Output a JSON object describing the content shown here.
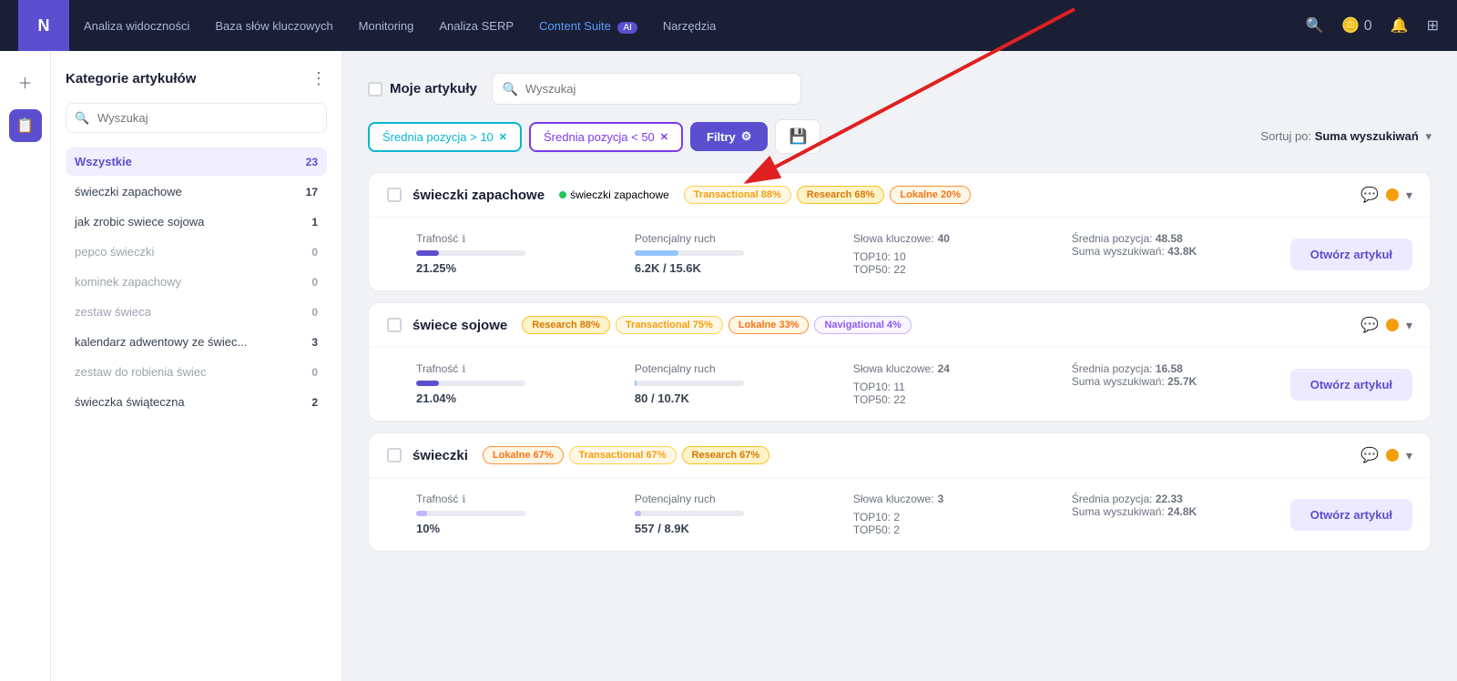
{
  "nav": {
    "logo": "N",
    "links": [
      {
        "label": "Analiza widoczności",
        "active": false
      },
      {
        "label": "Baza słów kluczowych",
        "active": false
      },
      {
        "label": "Monitoring",
        "active": false
      },
      {
        "label": "Analiza SERP",
        "active": false
      },
      {
        "label": "Content Suite",
        "active": true,
        "highlight": true,
        "badge": "AI"
      },
      {
        "label": "Narzędzia",
        "active": false
      }
    ],
    "icons": [
      "search",
      "coins",
      "bell",
      "grid"
    ]
  },
  "sidebar_icons": [
    {
      "icon": "＋",
      "active": false
    },
    {
      "icon": "📅",
      "active": true
    }
  ],
  "left_panel": {
    "title": "Kategorie artykułów",
    "search_placeholder": "Wyszukaj",
    "categories": [
      {
        "name": "Wszystkie",
        "count": "23",
        "active": true,
        "disabled": false
      },
      {
        "name": "świeczki zapachowe",
        "count": "17",
        "active": false,
        "disabled": false
      },
      {
        "name": "jak zrobic swiece sojowa",
        "count": "1",
        "active": false,
        "disabled": false
      },
      {
        "name": "pepco świeczki",
        "count": "0",
        "active": false,
        "disabled": true
      },
      {
        "name": "kominek zapachowy",
        "count": "0",
        "active": false,
        "disabled": true
      },
      {
        "name": "zestaw świeca",
        "count": "0",
        "active": false,
        "disabled": true
      },
      {
        "name": "kalendarz adwentowy ze świec...",
        "count": "3",
        "active": false,
        "disabled": false
      },
      {
        "name": "zestaw do robienia świec",
        "count": "0",
        "active": false,
        "disabled": true
      },
      {
        "name": "świeczka świąteczna",
        "count": "2",
        "active": false,
        "disabled": false
      }
    ]
  },
  "main": {
    "my_articles_label": "Moje artykuły",
    "search_placeholder": "Wyszukaj",
    "filters": [
      {
        "label": "Średnia pozycja > 10",
        "type": "cyan"
      },
      {
        "label": "Średnia pozycja < 50",
        "type": "violet"
      }
    ],
    "filter_button": "Filtry",
    "sort_label": "Sortuj po:",
    "sort_value": "Suma wyszukiwań",
    "articles": [
      {
        "title": "świeczki zapachowe",
        "keyword": "świeczki zapachowe",
        "intents": [
          {
            "label": "Transactional 88%",
            "type": "transactional"
          },
          {
            "label": "Research 68%",
            "type": "research"
          },
          {
            "label": "Lokalne 20%",
            "type": "lokalne"
          }
        ],
        "trafnosc_value": "21.25%",
        "trafnosc_pct": 21,
        "potencjalny_ruch": "6.2K / 15.6K",
        "potencjalny_ruch_pct": 40,
        "slowa_kluczowe": "40",
        "top10": "10",
        "top50": "22",
        "srednia_pozycja": "48.58",
        "suma_wyszukiwan": "43.8K",
        "open_label": "Otwórz artykuł"
      },
      {
        "title": "świece sojowe",
        "keyword": null,
        "intents": [
          {
            "label": "Research 88%",
            "type": "research"
          },
          {
            "label": "Transactional 75%",
            "type": "transactional"
          },
          {
            "label": "Lokalne 33%",
            "type": "lokalne"
          },
          {
            "label": "Navigational 4%",
            "type": "navigational"
          }
        ],
        "trafnosc_value": "21.04%",
        "trafnosc_pct": 21,
        "potencjalny_ruch": "80 / 10.7K",
        "potencjalny_ruch_pct": 2,
        "slowa_kluczowe": "24",
        "top10": "11",
        "top50": "22",
        "srednia_pozycja": "16.58",
        "suma_wyszukiwan": "25.7K",
        "open_label": "Otwórz artykuł"
      },
      {
        "title": "świeczki",
        "keyword": null,
        "intents": [
          {
            "label": "Lokalne 67%",
            "type": "lokalne"
          },
          {
            "label": "Transactional 67%",
            "type": "transactional"
          },
          {
            "label": "Research 67%",
            "type": "research"
          }
        ],
        "trafnosc_value": "10%",
        "trafnosc_pct": 10,
        "potencjalny_ruch": "557 / 8.9K",
        "potencjalny_ruch_pct": 6,
        "slowa_kluczowe": "3",
        "top10": "2",
        "top50": "2",
        "srednia_pozycja": "22.33",
        "suma_wyszukiwan": "24.8K",
        "open_label": "Otwórz artykuł"
      }
    ]
  }
}
